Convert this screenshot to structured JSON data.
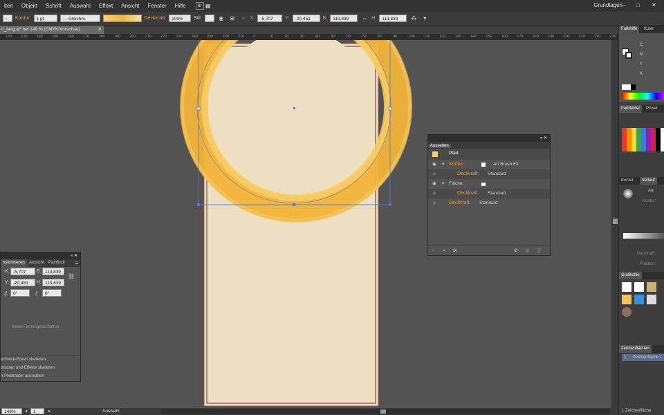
{
  "menu": {
    "items": [
      "iten",
      "Objekt",
      "Schrift",
      "Auswahl",
      "Effekt",
      "Ansicht",
      "Fenster",
      "Hilfe"
    ],
    "workspace": "Grundlagen"
  },
  "control": {
    "kontur_label": "Kontur:",
    "stroke_weight": "1 pt",
    "stroke_profile": "Gleichm.",
    "opacity_label": "Deckkraft:",
    "opacity_value": "100%",
    "style_label": "Stil:",
    "x_label": "X:",
    "x_value": "-5,707 mm",
    "y_label": "Y:",
    "y_value": "-20,453 mm",
    "b_label": "B:",
    "b_value": "113,839 mm",
    "h_label": "H:",
    "h_value": "113,839 mm"
  },
  "document": {
    "tab_title": "n_lang.ai* bei 149 % (CMYK/Vorschau)"
  },
  "ruler": {
    "ticks": [
      "120",
      "130",
      "140",
      "150",
      "160",
      "170",
      "180",
      "190",
      "200",
      "210",
      "220",
      "230",
      "240",
      "250",
      "260",
      "270",
      "0",
      "10",
      "20",
      "30",
      "40",
      "50",
      "60",
      "70",
      "80",
      "90",
      "100",
      "110",
      "120",
      "130",
      "140",
      "150",
      "160",
      "170",
      "180",
      "190",
      "200",
      "210",
      "220",
      "230"
    ]
  },
  "appearance": {
    "tab": "Aussehen",
    "object": "Pfad",
    "rows": [
      {
        "label": "Kontur:",
        "value": "Art Brush 63"
      },
      {
        "label": "Deckkraft:",
        "value": "Standard"
      },
      {
        "label": "Fläche:",
        "value": ""
      },
      {
        "label": "Deckkraft:",
        "value": "Standard"
      },
      {
        "label": "Deckkraft:",
        "value": "Standard"
      }
    ]
  },
  "transform": {
    "tabs": [
      "nsformieren",
      "Ausricht",
      "Pathfindr"
    ],
    "x_label": "X:",
    "x_value": "-5,707 mm",
    "y_label": "Y:",
    "y_value": "-20,453 mm",
    "b_label": "B:",
    "b_value": "113,839 mm",
    "h_label": "H:",
    "h_value": "113,839 mm",
    "angle": "0°",
    "shear": "0°",
    "no_props": "Keine Formeigenschaften",
    "options": [
      "echteck-Ecken skalieren",
      "onturen und Effekte skalieren",
      "n Pixelraster ausrichten"
    ]
  },
  "dock": {
    "color_tabs": [
      "Farbhilfe",
      "Kuler"
    ],
    "cmyk_labels": [
      "C",
      "M",
      "Y",
      "K"
    ],
    "swatch_tabs": [
      "Farbfelder",
      "Pinsel"
    ],
    "stroke_tabs": [
      "Kontur",
      "Verlauf"
    ],
    "art_label": "Art:",
    "kontur_label": "Kontur:",
    "deckkraft_label": "Deckkraft:",
    "position_label": "Position:",
    "graphic_styles_tab": "Grafikstile",
    "artboards_tab": "Zeichenflächen",
    "artboard_num": "1",
    "artboard_name": "Zeichenfläche 1",
    "artboard_count": "1 Zeichenfläche"
  },
  "status": {
    "zoom": "149%",
    "page": "1",
    "mode": "Auswahl"
  },
  "colors": {
    "accent_orange": "#e8993b",
    "paper": "#ecdfc2",
    "ring": "#f5b53a",
    "selection": "#4a7ae0"
  }
}
